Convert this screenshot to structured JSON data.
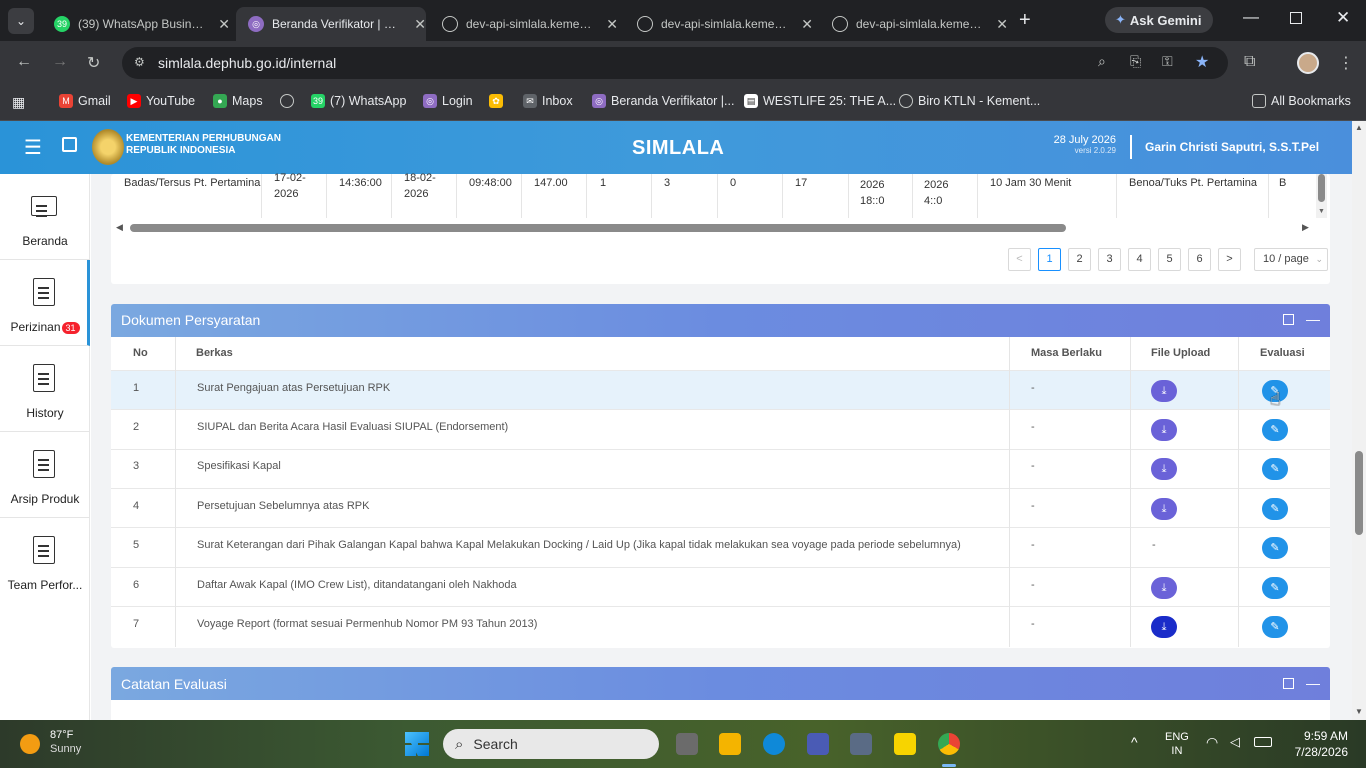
{
  "browser": {
    "tabs": [
      {
        "title": "(39) WhatsApp Business",
        "badge": "39"
      },
      {
        "title": "Beranda Verifikator | Simlala"
      },
      {
        "title": "dev-api-simlala.kemenhub"
      },
      {
        "title": "dev-api-simlala.kemenhub"
      },
      {
        "title": "dev-api-simlala.kemenhub"
      }
    ],
    "ask_gemini": "Ask Gemini",
    "url": "simlala.dephub.go.id/internal",
    "bookmarks": [
      "Gmail",
      "YouTube",
      "Maps",
      "(7) WhatsApp",
      "Login",
      "Inbox",
      "Beranda Verifikator |...",
      "WESTLIFE 25: THE A...",
      "Biro KTLN - Kement..."
    ],
    "bookmark_badge": "39",
    "all_bookmarks": "All Bookmarks"
  },
  "app": {
    "org_line1": "KEMENTERIAN PERHUBUNGAN",
    "org_line2": "REPUBLIK INDONESIA",
    "title": "SIMLALA",
    "date": "28 July 2026",
    "version": "versi 2.0.29",
    "user": "Garin Christi Saputri, S.S.T.Pel"
  },
  "sidebar": [
    {
      "label": "Beranda"
    },
    {
      "label": "Perizinan",
      "badge": "31"
    },
    {
      "label": "History"
    },
    {
      "label": "Arsip Produk"
    },
    {
      "label": "Team Perfor..."
    }
  ],
  "top_table_row": {
    "c1": "Badas/Tersus Pt. Pertamina",
    "c2a": "17-02-",
    "c2b": "2026",
    "c3": "14:36:00",
    "c4a": "18-02-",
    "c4b": "2026",
    "c5": "09:48:00",
    "c6": "147.00",
    "c7": "1",
    "c8": "3",
    "c9": "0",
    "c10": "17",
    "c11a": "2026",
    "c11b": "18::0",
    "c12a": "2026",
    "c12b": "4::0",
    "c13": "10 Jam 30 Menit",
    "c14": "Benoa/Tuks Pt. Pertamina",
    "c15": "B"
  },
  "pagination": {
    "pages": [
      "1",
      "2",
      "3",
      "4",
      "5",
      "6"
    ],
    "current": "1",
    "per_page": "10 / page",
    "prev": "<",
    "next": ">"
  },
  "dokumen": {
    "title": "Dokumen Persyaratan",
    "headers": {
      "no": "No",
      "berkas": "Berkas",
      "masa": "Masa Berlaku",
      "file": "File Upload",
      "evaluasi": "Evaluasi"
    },
    "rows": [
      {
        "no": "1",
        "berkas": "Surat Pengajuan atas Persetujuan RPK",
        "masa": "-",
        "file": "download"
      },
      {
        "no": "2",
        "berkas": "SIUPAL dan Berita Acara Hasil Evaluasi SIUPAL (Endorsement)",
        "masa": "-",
        "file": "download"
      },
      {
        "no": "3",
        "berkas": "Spesifikasi Kapal",
        "masa": "-",
        "file": "download"
      },
      {
        "no": "4",
        "berkas": "Persetujuan Sebelumnya atas RPK",
        "masa": "-",
        "file": "download"
      },
      {
        "no": "5",
        "berkas": "Surat Keterangan dari Pihak Galangan Kapal bahwa Kapal Melakukan Docking / Laid Up (Jika kapal tidak melakukan sea voyage pada periode sebelumnya)",
        "masa": "-",
        "file": "-"
      },
      {
        "no": "6",
        "berkas": "Daftar Awak Kapal (IMO Crew List), ditandatangani oleh Nakhoda",
        "masa": "-",
        "file": "download"
      },
      {
        "no": "7",
        "berkas": "Voyage Report (format sesuai Permenhub Nomor PM 93 Tahun 2013)",
        "masa": "-",
        "file": "download"
      }
    ]
  },
  "catatan": {
    "title": "Catatan Evaluasi"
  },
  "taskbar": {
    "weather_temp": "87°F",
    "weather_desc": "Sunny",
    "search": "Search",
    "lang1": "ENG",
    "lang2": "IN",
    "time": "9:59 AM",
    "date": "7/28/2026"
  }
}
